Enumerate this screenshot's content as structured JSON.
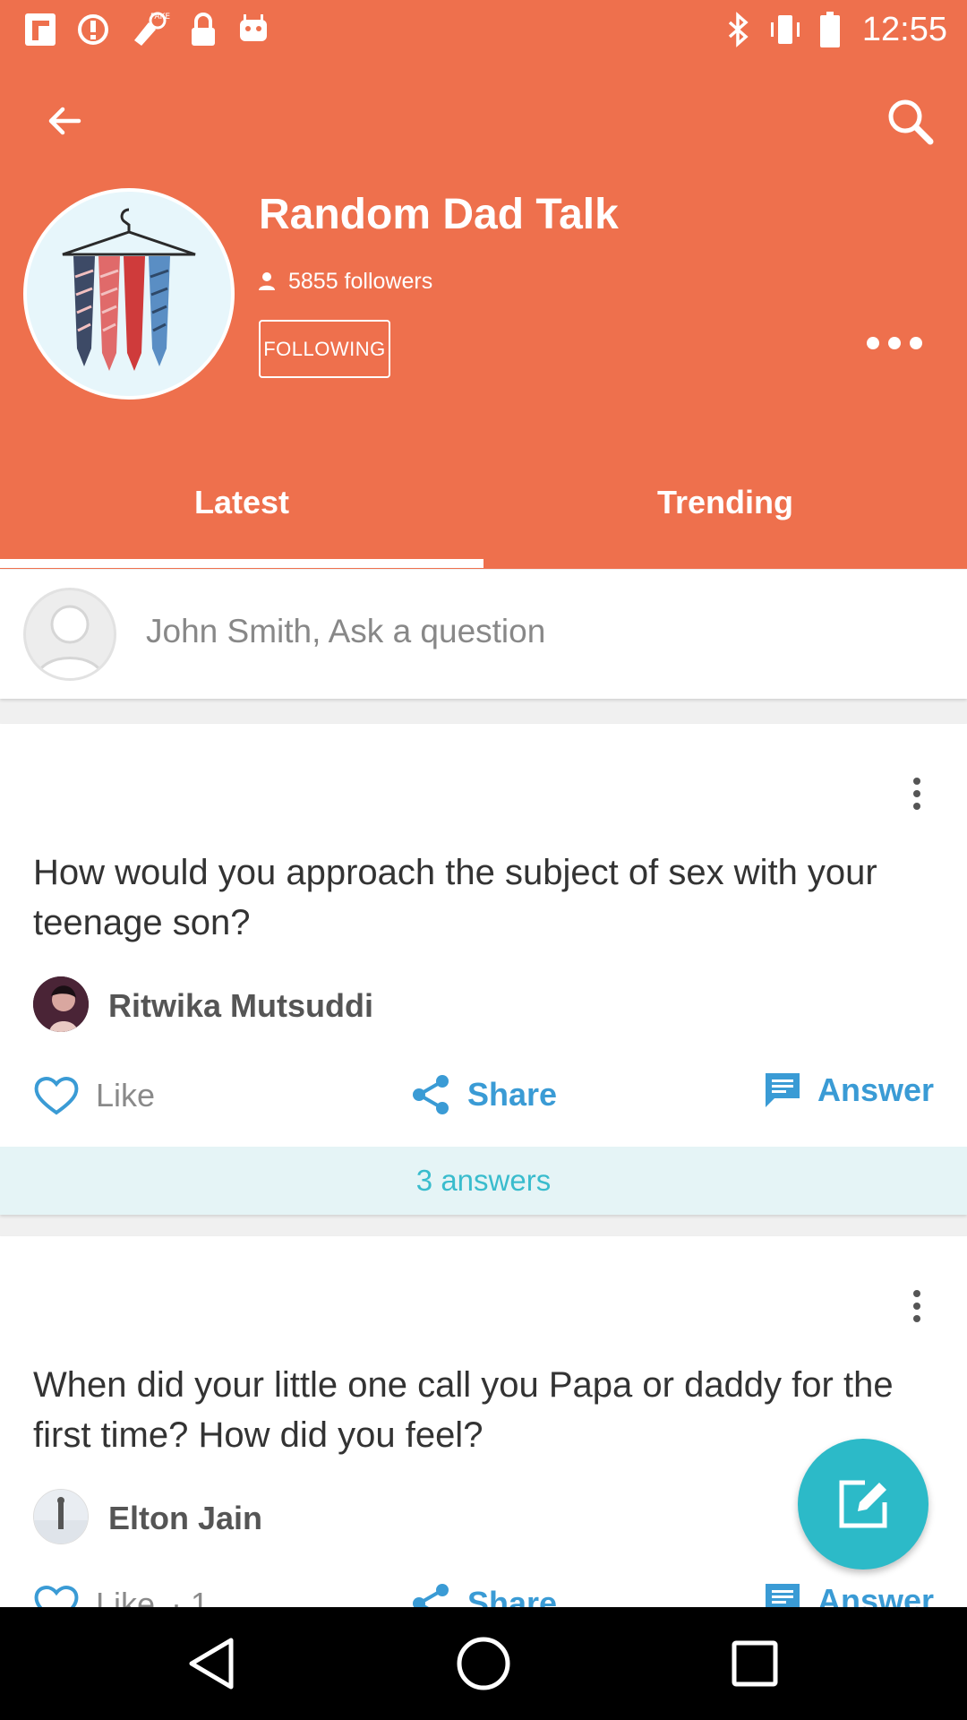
{
  "status_bar": {
    "time": "12:55",
    "left_icons": [
      "app-notification-icon",
      "warning-icon",
      "fake-gps-icon",
      "lock-icon",
      "android-icon"
    ],
    "right_icons": [
      "bluetooth-icon",
      "vibrate-icon",
      "battery-icon"
    ]
  },
  "header": {
    "title": "Random Dad Talk",
    "followers": "5855 followers",
    "follow_button": "FOLLOWING",
    "background": "#ee704d"
  },
  "tabs": [
    {
      "label": "Latest",
      "active": true
    },
    {
      "label": "Trending",
      "active": false
    }
  ],
  "ask": {
    "placeholder": "John Smith, Ask a question"
  },
  "posts": [
    {
      "question": "How would you approach the subject of sex with your teenage son?",
      "author": "Ritwika Mutsuddi",
      "like_label": "Like",
      "share_label": "Share",
      "answer_label": "Answer",
      "answers_count": "3 answers"
    },
    {
      "question": "When did your little one call you Papa or daddy for the first time? How did you feel?",
      "author": "Elton Jain",
      "like_label": "Like",
      "like_count": "1",
      "share_label": "Share",
      "answer_label": "Answer"
    }
  ],
  "colors": {
    "accent": "#ee704d",
    "teal": "#2cbac8",
    "link_blue": "#3a9bd5"
  }
}
